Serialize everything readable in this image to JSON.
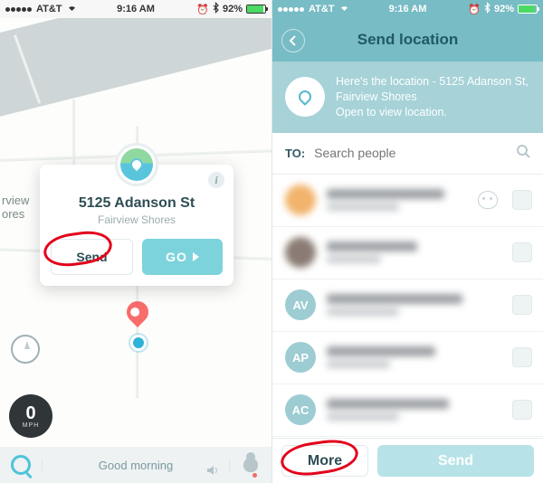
{
  "status": {
    "carrier": "AT&T",
    "time": "9:16 AM",
    "battery_pct": "92%"
  },
  "left": {
    "road_label_line1": "rview",
    "road_label_line2": "ores",
    "card": {
      "title": "5125 Adanson St",
      "subtitle": "Fairview Shores",
      "send_label": "Send",
      "go_label": "GO"
    },
    "speed_value": "0",
    "speed_unit": "MPH",
    "greeting": "Good morning"
  },
  "right": {
    "header_title": "Send location",
    "loc_line1": "Here's the location - 5125 Adanson St, Fairview Shores",
    "loc_line2": "Open to view location.",
    "to_label": "TO:",
    "search_placeholder": "Search people",
    "contacts": {
      "c3_initials": "AV",
      "c4_initials": "AP",
      "c5_initials": "AC"
    },
    "more_label": "More",
    "send_label": "Send"
  }
}
